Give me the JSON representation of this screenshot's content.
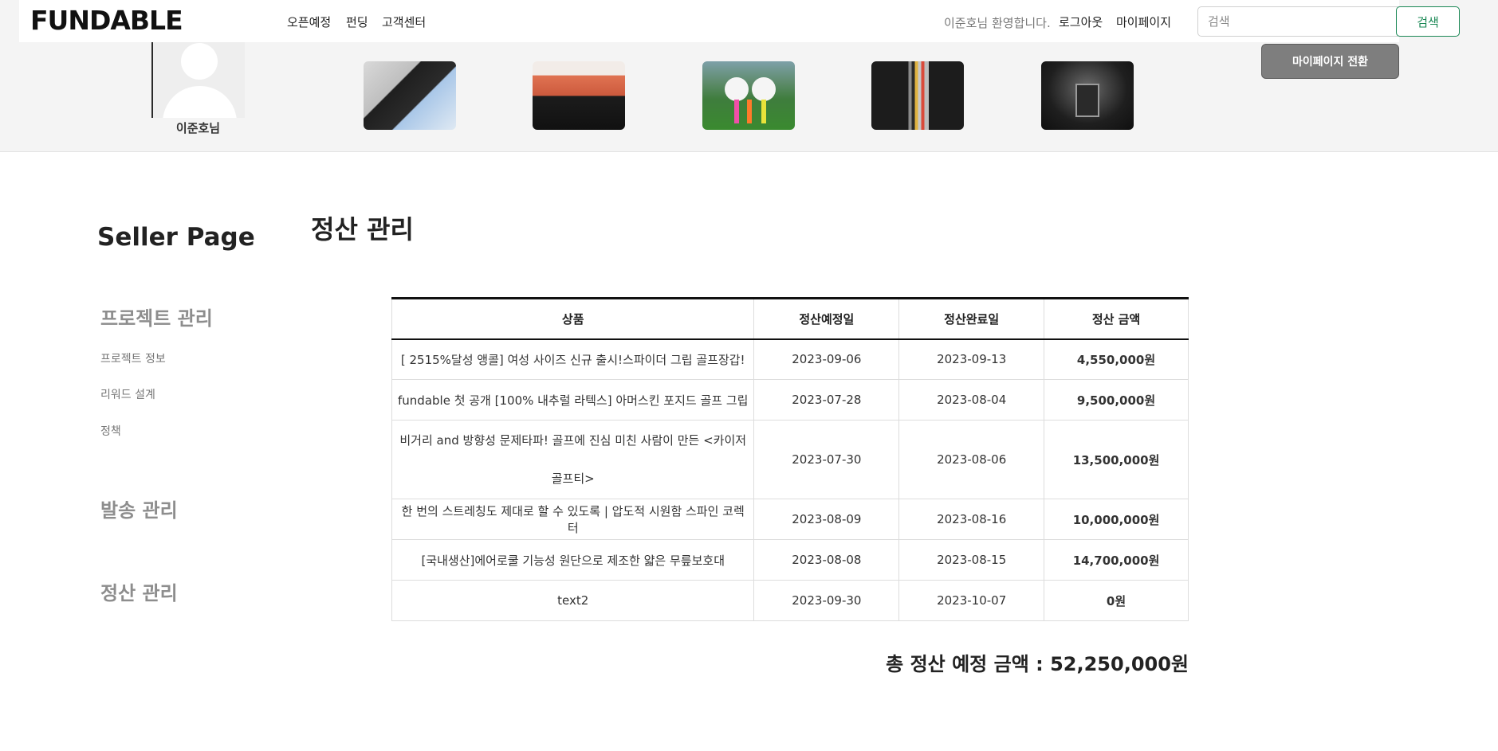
{
  "header": {
    "logo": "FUNDABLE",
    "nav": [
      "오픈예정",
      "펀딩",
      "고객센터"
    ],
    "welcome": "이준호님 환영합니다.",
    "logout": "로그아웃",
    "mypage": "마이페이지",
    "search_placeholder": "검색",
    "search_button": "검색"
  },
  "profile": {
    "name": "이준호님",
    "switch_button": "마이페이지 전환"
  },
  "sidebar": {
    "title": "Seller Page",
    "project_head": "프로젝트 관리",
    "project_items": [
      "프로젝트 정보",
      "리워드 설계",
      "정책"
    ],
    "shipping_head": "발송 관리",
    "settlement_head": "정산 관리"
  },
  "main": {
    "title": "정산 관리",
    "columns": [
      "상품",
      "정산예정일",
      "정산완료일",
      "정산 금액"
    ],
    "rows": [
      {
        "product": "[ 2515%달성 앵콜] 여성 사이즈 신규 출시!스파이더 그립 골프장갑!",
        "scheduled": "2023-09-06",
        "completed": "2023-09-13",
        "amount": "4,550,000원"
      },
      {
        "product": "fundable 첫 공개 [100% 내추럴 라텍스] 아머스킨 포지드 골프 그립",
        "scheduled": "2023-07-28",
        "completed": "2023-08-04",
        "amount": "9,500,000원"
      },
      {
        "product": "비거리 and 방향성 문제타파! 골프에 진심 미친 사람이 만든 <카이저 골프티>",
        "scheduled": "2023-07-30",
        "completed": "2023-08-06",
        "amount": "13,500,000원"
      },
      {
        "product": "한 번의 스트레칭도 제대로 할 수 있도록 | 압도적 시원함 스파인 코렉터",
        "scheduled": "2023-08-09",
        "completed": "2023-08-16",
        "amount": "10,000,000원"
      },
      {
        "product": "[국내생산]에어로쿨 기능성 원단으로 제조한 얇은 무릎보호대",
        "scheduled": "2023-08-08",
        "completed": "2023-08-15",
        "amount": "14,700,000원"
      },
      {
        "product": "text2",
        "scheduled": "2023-09-30",
        "completed": "2023-10-07",
        "amount": "0원"
      }
    ],
    "total": "총 정산 예정 금액 : 52,250,000원"
  }
}
